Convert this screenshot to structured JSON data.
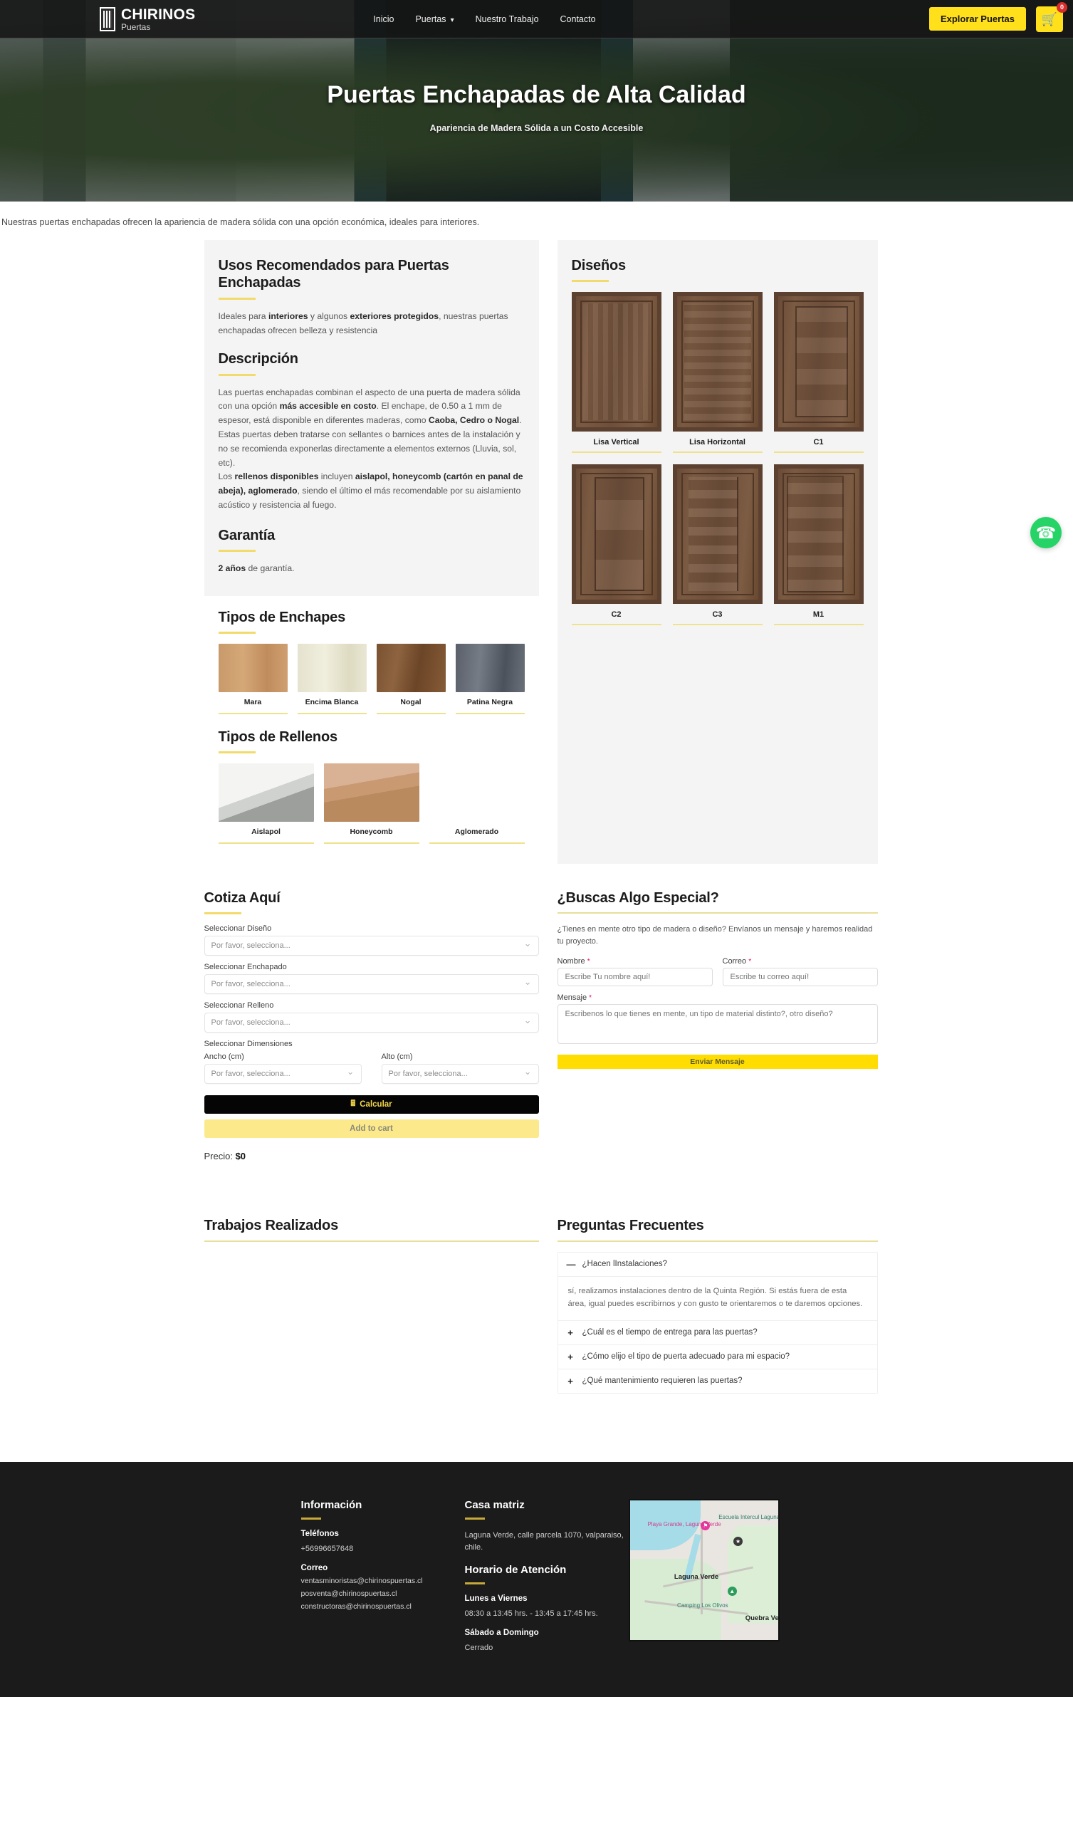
{
  "header": {
    "logo_name": "CHIRINOS",
    "logo_sub": "Puertas",
    "nav": [
      {
        "label": "Inicio",
        "caret": false
      },
      {
        "label": "Puertas",
        "caret": true
      },
      {
        "label": "Nuestro Trabajo",
        "caret": false
      },
      {
        "label": "Contacto",
        "caret": false
      }
    ],
    "cta_label": "Explorar Puertas",
    "cart_count": "0",
    "cart_icon": "shopping-cart-icon"
  },
  "hero": {
    "title": "Puertas Enchapadas de Alta Calidad",
    "subtitle": "Apariencia de Madera Sólida a un Costo Accesible"
  },
  "intro": {
    "text": "Nuestras puertas enchapadas ofrecen la apariencia de madera sólida con una opción económica, ideales para interiores."
  },
  "usos": {
    "title": "Usos Recomendados para Puertas Enchapadas",
    "paragraph_html": "Ideales para <b>interiores</b> y algunos <b>exteriores protegidos</b>, nuestras puertas enchapadas ofrecen belleza y resistencia"
  },
  "descripcion": {
    "title": "Descripción",
    "p1_html": "Las puertas enchapadas combinan el aspecto de una puerta de madera sólida con una opción <b>más accesible en costo</b>. El enchape, de 0.50 a 1 mm de espesor, está disponible en diferentes maderas, como <b>Caoba, Cedro o Nogal</b>.",
    "p2_html": "Estas puertas deben tratarse con sellantes o barnices antes de la instalación y no se recomienda exponerlas directamente a elementos externos (Lluvia, sol, etc).",
    "p3_html": "Los <b>rellenos disponibles</b> incluyen <b>aislapol, honeycomb (cartón en panal de abeja), aglomerado</b>, siendo el último el más recomendable por su aislamiento acústico y resistencia al fuego."
  },
  "garantia": {
    "title": "Garantía",
    "text_html": "<b>2 años</b> de garantía."
  },
  "enchapes": {
    "title": "Tipos de Enchapes",
    "items": [
      {
        "label": "Mara",
        "swatch": "sw-mara"
      },
      {
        "label": "Encima Blanca",
        "swatch": "sw-encima"
      },
      {
        "label": "Nogal",
        "swatch": "sw-nogal"
      },
      {
        "label": "Patina Negra",
        "swatch": "sw-patina"
      }
    ]
  },
  "rellenos": {
    "title": "Tipos de Rellenos",
    "items": [
      {
        "label": "Aislapol",
        "swatch": "sw-aislapol"
      },
      {
        "label": "Honeycomb",
        "swatch": "sw-honey"
      },
      {
        "label": "Aglomerado",
        "swatch": "sw-aglom"
      }
    ]
  },
  "disenos": {
    "title": "Diseños",
    "items": [
      {
        "label": "Lisa Vertical",
        "style": "vert"
      },
      {
        "label": "Lisa Horizontal",
        "style": "horz"
      },
      {
        "label": "C1",
        "style": "c1"
      },
      {
        "label": "C2",
        "style": "c2"
      },
      {
        "label": "C3",
        "style": "c3"
      },
      {
        "label": "M1",
        "style": "m1"
      }
    ]
  },
  "cotizador": {
    "title": "Cotiza Aquí",
    "label_diseno": "Seleccionar Diseño",
    "label_enchapado": "Seleccionar Enchapado",
    "label_relleno": "Seleccionar Relleno",
    "label_dimensiones": "Seleccionar Dimensiones",
    "label_ancho": "Ancho (cm)",
    "label_alto": "Alto (cm)",
    "select_placeholder": "Por favor, selecciona...",
    "calc_label": "Calcular",
    "calc_icon": "calculator-icon",
    "cart_label": "Add to cart",
    "price_prefix": "Precio: ",
    "price_value": "$0"
  },
  "contacto": {
    "title": "¿Buscas Algo Especial?",
    "intro": "¿Tienes en mente otro tipo de madera o diseño? Envíanos un mensaje y haremos realidad tu proyecto.",
    "label_nombre": "Nombre",
    "label_correo": "Correo",
    "label_mensaje": "Mensaje",
    "required_mark": "*",
    "ph_nombre": "Escribe Tu nombre aquí!",
    "ph_correo": "Escribe tu correo aquí!",
    "ph_mensaje": "Escribenos lo que tienes en mente, un tipo de material distinto?, otro diseño?",
    "send_label": "Enviar Mensaje"
  },
  "trabajos": {
    "title": "Trabajos Realizados"
  },
  "faq": {
    "title": "Preguntas Frecuentes",
    "items": [
      {
        "sign": "—",
        "question": "¿Hacen lInstalaciones?",
        "answer": "sí, realizamos instalaciones dentro de la Quinta Región. Si estás fuera de esta área, igual puedes escribirnos y con gusto te orientaremos o te daremos opciones.",
        "open": true
      },
      {
        "sign": "+",
        "question": "¿Cuál es el tiempo de entrega para las puertas?",
        "answer": "",
        "open": false
      },
      {
        "sign": "+",
        "question": "¿Cómo elijo el tipo de puerta adecuado para mi espacio?",
        "answer": "",
        "open": false
      },
      {
        "sign": "+",
        "question": "¿Qué mantenimiento requieren las puertas?",
        "answer": "",
        "open": false
      }
    ]
  },
  "footer": {
    "info_title": "Información",
    "phones_title": "Teléfonos",
    "phone": "+56996657648",
    "mail_title": "Correo",
    "emails": [
      "ventasminoristas@chirinospuertas.cl",
      "posventa@chirinospuertas.cl",
      "constructoras@chirinospuertas.cl"
    ],
    "casa_title": "Casa matriz",
    "address": "Laguna Verde, calle parcela 1070, valparaiso, chile.",
    "horario_title": "Horario de Atención",
    "weekdays_label": "Lunes a Viernes",
    "weekdays_hours": "08:30 a 13:45 hrs. - 13:45 a 17:45 hrs.",
    "weekend_label": "Sábado a Domingo",
    "weekend_hours": "Cerrado",
    "map": {
      "labels": [
        "Playa Grande, Laguna Verde",
        "Escuela Intercul Laguna Verde",
        "Laguna Verde",
        "Camping Los Olivos",
        "Quebra Verd"
      ]
    }
  },
  "whatsapp": {
    "icon": "whatsapp-icon",
    "label": "WhatsApp"
  },
  "colors": {
    "accent_yellow": "#FFE01B",
    "rule_yellow": "#F2DB6A",
    "dark": "#1B1B1B",
    "whatsapp_green": "#25D366"
  }
}
